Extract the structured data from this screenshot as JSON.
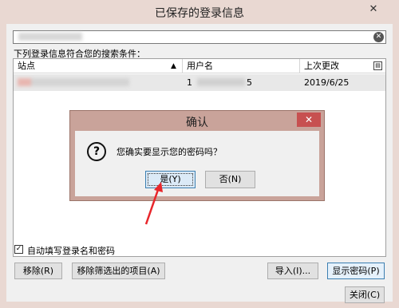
{
  "window": {
    "title": "已保存的登录信息"
  },
  "search": {
    "placeholder": ""
  },
  "criteria_label": "下列登录信息符合您的搜索条件：",
  "table": {
    "headers": {
      "site": "站点",
      "username": "用户名",
      "last_changed": "上次更改"
    },
    "rows": [
      {
        "username_start": "1",
        "username_end": "5",
        "last_changed": "2019/6/25"
      }
    ]
  },
  "autofill": {
    "label": "自动填写登录名和密码",
    "checked": true,
    "check_glyph": "✓"
  },
  "buttons": {
    "remove": "移除(R)",
    "remove_filtered": "移除筛选出的项目(A)",
    "import": "导入(I)...",
    "show_passwords": "显示密码(P)",
    "close": "关闭(C)"
  },
  "dialog": {
    "title": "确认",
    "message": "您确实要显示您的密码吗？",
    "yes": "是(Y)",
    "no": "否(N)",
    "close_glyph": "✕",
    "icon_glyph": "?"
  },
  "icons": {
    "window_close": "✕",
    "clear": "✕",
    "sort": "▲",
    "column_picker": "▤"
  },
  "colors": {
    "accent": "#3c7fb1",
    "dialog_close": "#c75050",
    "annotation_arrow": "#e8262b"
  }
}
